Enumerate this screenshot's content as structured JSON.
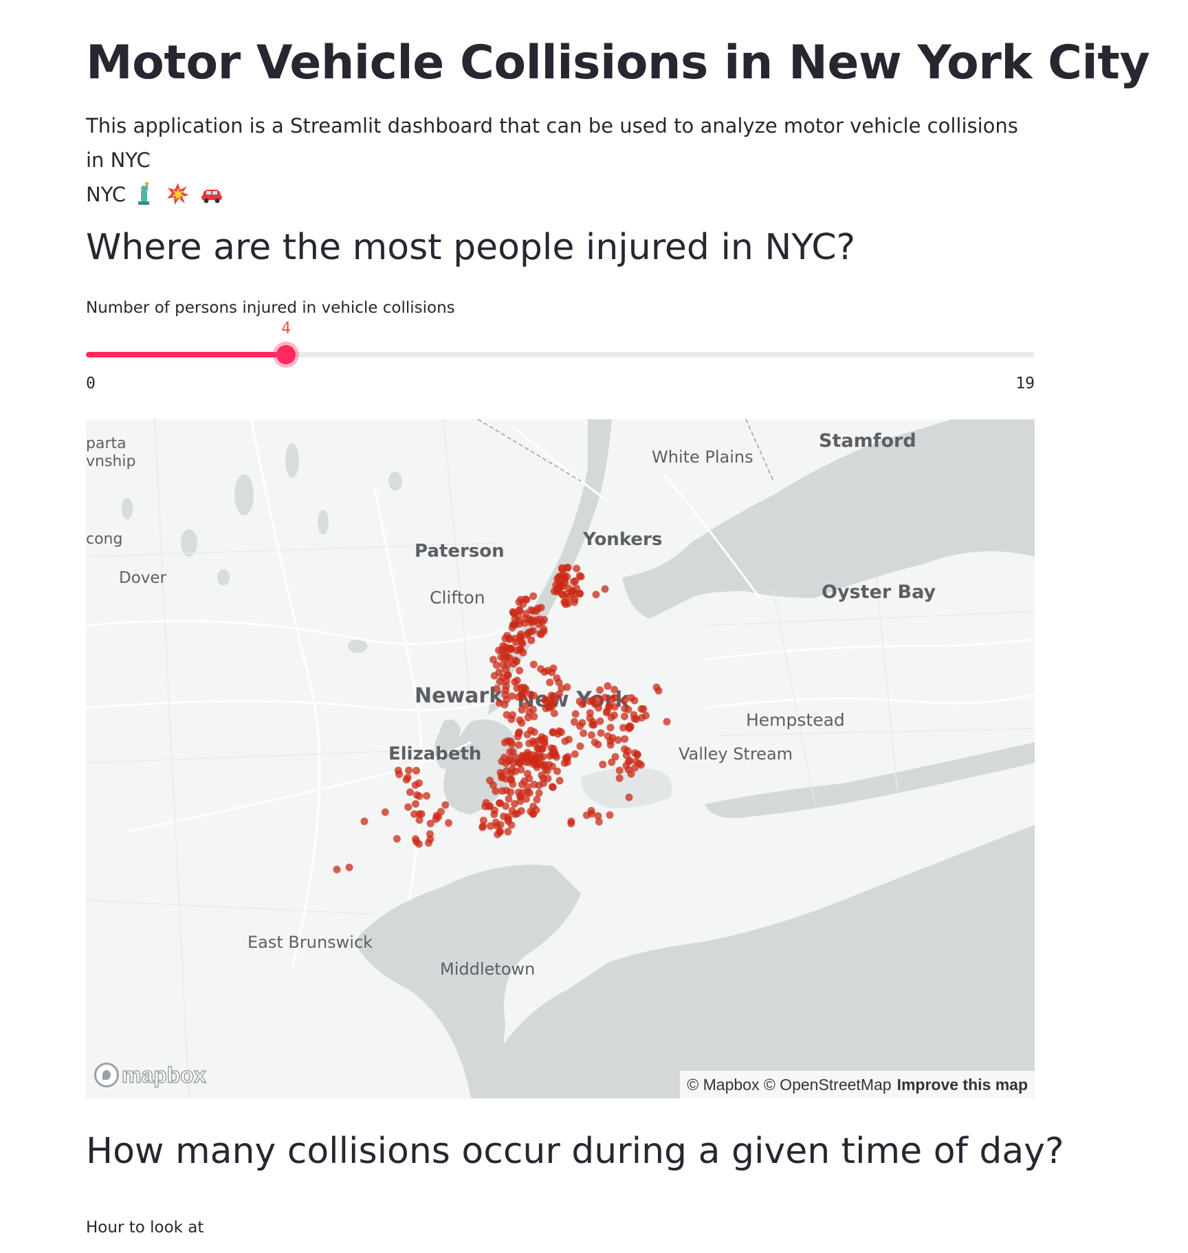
{
  "page": {
    "title": "Motor Vehicle Collisions in New York City",
    "description": "This application is a Streamlit dashboard that can be used to analyze motor vehicle collisions in NYC",
    "description_emojis": [
      "statue-of-liberty-emoji",
      "collision-emoji",
      "car-emoji"
    ]
  },
  "section1": {
    "heading": "Where are the most people injured in NYC?",
    "slider": {
      "label": "Number of persons injured in vehicle collisions",
      "value": 4,
      "min": 0,
      "max": 19,
      "min_label": "0",
      "max_label": "19",
      "value_label": "4",
      "accent_color": "#ff2b5e"
    }
  },
  "map": {
    "places": {
      "sparta": "parta",
      "township": "vnship",
      "white_plains": "White Plains",
      "stamford": "Stamford",
      "long": "cong",
      "yonkers": "Yonkers",
      "paterson": "Paterson",
      "dover": "Dover",
      "oyster_bay": "Oyster Bay",
      "clifton": "Clifton",
      "newark": "Newark",
      "new_york": "New York",
      "hempstead": "Hempstead",
      "elizabeth": "Elizabeth",
      "valley_stream": "Valley Stream",
      "east_brunswick": "East Brunswick",
      "middletown": "Middletown"
    },
    "logo_text": "mapbox",
    "attribution": "© Mapbox © OpenStreetMap",
    "improve_link": "Improve this map",
    "point_color": "#cc2a15",
    "water_color": "#d4d8d9",
    "land_color": "#f4f5f5"
  },
  "section2": {
    "heading": "How many collisions occur during a given time of day?",
    "hour_label": "Hour to look at"
  }
}
